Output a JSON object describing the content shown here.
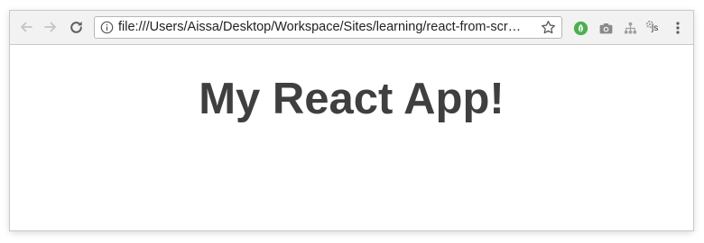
{
  "browser": {
    "toolbar": {
      "back_icon": "arrow-left-icon",
      "forward_icon": "arrow-right-icon",
      "reload_icon": "reload-icon"
    },
    "omnibox": {
      "url": "file:///Users/Aissa/Desktop/Workspace/Sites/learning/react-from-scr…",
      "info_icon": "info-icon",
      "bookmark_icon": "star-icon"
    },
    "extensions": {
      "items": [
        {
          "icon": "green-leaf-icon",
          "color": "#4caf50"
        },
        {
          "icon": "camera-icon",
          "color": "#8a8a8a"
        },
        {
          "icon": "network-icon",
          "color": "#a0a0a0"
        },
        {
          "icon": "js-icon",
          "label": "js",
          "color": "#9e9e9e"
        }
      ],
      "menu_icon": "more-vertical-icon"
    }
  },
  "page": {
    "heading": "My React App!",
    "heading_color": "#3f3f3f"
  }
}
